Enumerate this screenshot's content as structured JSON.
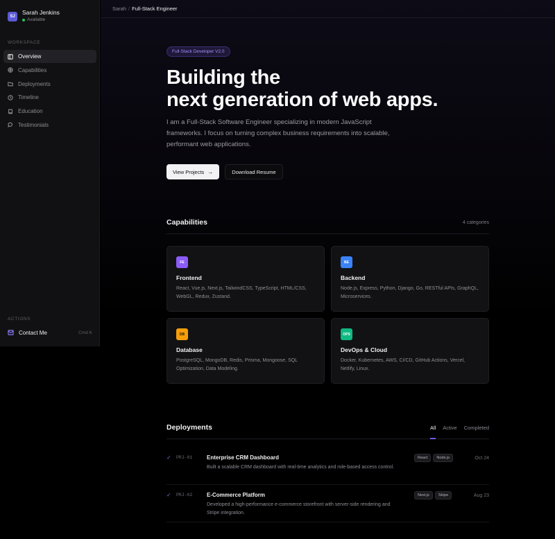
{
  "profile": {
    "initials": "SJ",
    "name": "Sarah Jenkins",
    "status": "Available"
  },
  "sidebar": {
    "workspace_label": "WORKSPACE",
    "items": [
      {
        "label": "Overview",
        "icon": "layout-icon",
        "active": true
      },
      {
        "label": "Capabilities",
        "icon": "sparkle-icon"
      },
      {
        "label": "Deployments",
        "icon": "folder-icon"
      },
      {
        "label": "Timeline",
        "icon": "clock-icon"
      },
      {
        "label": "Education",
        "icon": "book-icon"
      },
      {
        "label": "Testimonials",
        "icon": "chat-icon"
      }
    ],
    "actions_label": "ACTIONS",
    "contact_label": "Contact Me",
    "contact_shortcut": "Cmd K"
  },
  "breadcrumb": {
    "parent": "Sarah",
    "separator": "/",
    "current": "Full-Stack Engineer"
  },
  "hero": {
    "badge": "Full-Stack Developer V2.0",
    "title_line1": "Building the",
    "title_line2": "next generation of web apps.",
    "description": "I am a Full-Stack Software Engineer specializing in modern JavaScript frameworks. I focus on turning complex business requirements into scalable, performant web applications.",
    "primary_button": "View Projects",
    "secondary_button": "Download Resume"
  },
  "capabilities": {
    "title": "Capabilities",
    "meta": "4 categories",
    "cards": [
      {
        "code": "FE",
        "title": "Frontend",
        "desc": "React, Vue.js, Next.js, TailwindCSS, TypeScript, HTML/CSS, WebGL, Redux, Zustand.",
        "color": "#8b5cf6",
        "text_color": "#ffffff"
      },
      {
        "code": "BE",
        "title": "Backend",
        "desc": "Node.js, Express, Python, Django, Go, RESTful APIs, GraphQL, Microservices.",
        "color": "#3b82f6",
        "text_color": "#ffffff"
      },
      {
        "code": "DB",
        "title": "Database",
        "desc": "PostgreSQL, MongoDB, Redis, Prisma, Mongoose, SQL Optimization, Data Modeling.",
        "color": "#f59e0b",
        "text_color": "#1a1200"
      },
      {
        "code": "OPS",
        "title": "DevOps & Cloud",
        "desc": "Docker, Kubernetes, AWS, CI/CD, GitHub Actions, Vercel, Netlify, Linux.",
        "color": "#10b981",
        "text_color": "#ffffff"
      }
    ]
  },
  "deployments": {
    "title": "Deployments",
    "tabs": [
      {
        "label": "All",
        "active": true
      },
      {
        "label": "Active"
      },
      {
        "label": "Completed"
      }
    ],
    "rows": [
      {
        "code": "PRJ-01",
        "title": "Enterprise CRM Dashboard",
        "desc": "Built a scalable CRM dashboard with real-time analytics and role-based access control.",
        "tags": [
          "React",
          "Node.js"
        ],
        "date": "Oct 24"
      },
      {
        "code": "PRJ-02",
        "title": "E-Commerce Platform",
        "desc": "Developed a high-performance e-commerce storefront with server-side rendering and Stripe integration.",
        "tags": [
          "Next.js",
          "Stripe"
        ],
        "date": "Aug 23"
      }
    ]
  }
}
